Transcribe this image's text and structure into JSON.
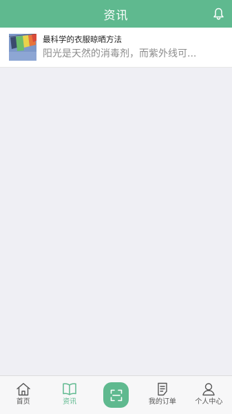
{
  "header": {
    "title": "资讯"
  },
  "news": [
    {
      "title": "最科学的衣服晾晒方法",
      "summary": "阳光是天然的消毒剂，而紫外线可..."
    }
  ],
  "tabbar": {
    "items": [
      {
        "label": "首页",
        "icon": "home-icon"
      },
      {
        "label": "资讯",
        "icon": "book-icon"
      },
      {
        "label": "",
        "icon": "scan-icon"
      },
      {
        "label": "我的订单",
        "icon": "order-icon"
      },
      {
        "label": "个人中心",
        "icon": "user-icon"
      }
    ]
  },
  "colors": {
    "primary": "#5fb98f",
    "background": "#efeff4"
  }
}
